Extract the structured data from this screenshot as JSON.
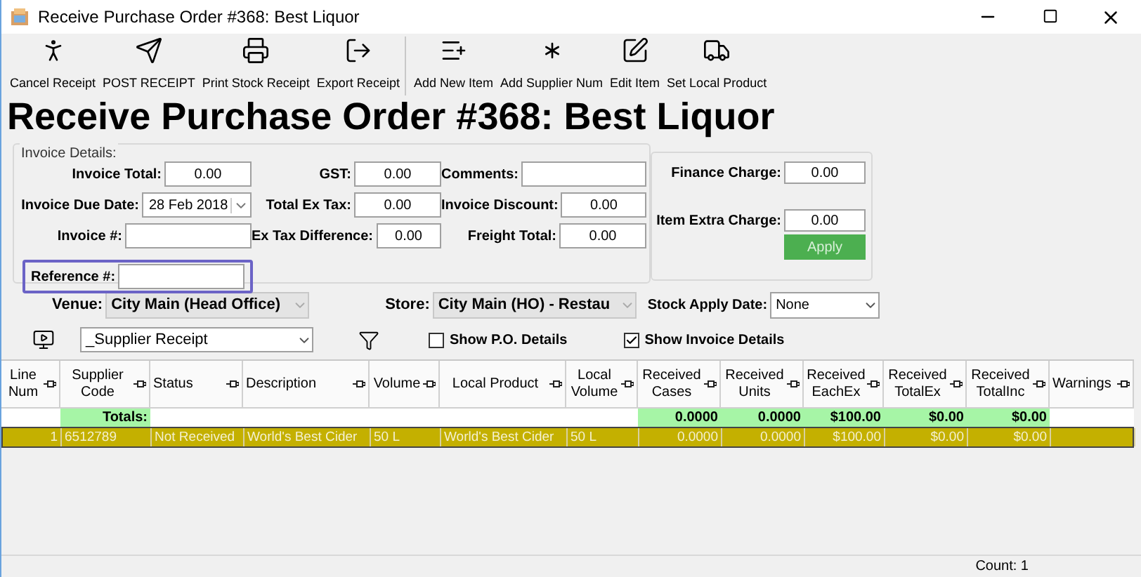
{
  "window": {
    "title": "Receive Purchase Order #368: Best Liquor"
  },
  "toolbar": {
    "groups": [
      [
        {
          "label": "Cancel Receipt"
        },
        {
          "label": "POST RECEIPT"
        },
        {
          "label": "Print Stock Receipt"
        },
        {
          "label": "Export Receipt"
        }
      ],
      [
        {
          "label": "Add New Item"
        },
        {
          "label": "Add Supplier Num"
        },
        {
          "label": "Edit Item"
        },
        {
          "label": "Set Local Product"
        }
      ]
    ]
  },
  "heading": "Receive Purchase Order #368: Best Liquor",
  "invoice_details": {
    "title": "Invoice Details:",
    "rows": [
      [
        {
          "label": "Invoice Total:",
          "value": "0.00",
          "kind": "number"
        },
        {
          "label": "GST:",
          "value": "0.00",
          "kind": "number"
        },
        {
          "label": "Comments:",
          "kind": "wide"
        }
      ],
      [
        {
          "label": "Invoice Due Date:",
          "value": "28 Feb 2018",
          "kind": "date"
        },
        {
          "label": "Total Ex Tax:",
          "value": "0.00",
          "kind": "number"
        },
        {
          "label": "Invoice Discount:",
          "value": "0.00",
          "kind": "number"
        }
      ],
      [
        {
          "label": "Invoice #:",
          "kind": "text"
        },
        {
          "label": "Ex Tax Difference:",
          "value": "0.00",
          "kind": "number"
        },
        {
          "label": "Freight Total:",
          "value": "0.00",
          "kind": "number"
        }
      ],
      [
        {
          "label": "Reference #:",
          "kind": "text",
          "highlighted": true
        }
      ]
    ],
    "charges": [
      {
        "label": "Finance Charge:",
        "value": "0.00"
      },
      {
        "label": "Item Extra Charge:",
        "value": "0.00"
      }
    ],
    "apply_button": "Apply"
  },
  "selectors": [
    {
      "label": "Venue:",
      "value": "City Main (Head Office)",
      "disabled": true
    },
    {
      "label": "Store:",
      "value": "City Main (HO) - Restau",
      "disabled": true
    },
    {
      "label": "Stock Apply Date:",
      "value": "None",
      "disabled": false
    }
  ],
  "view_select": {
    "value": "_Supplier Receipt"
  },
  "checkboxes": [
    {
      "label": "Show P.O. Details",
      "checked": false
    },
    {
      "label": "Show Invoice Details",
      "checked": true
    }
  ],
  "table": {
    "columns": [
      "Line Num",
      "Supplier Code",
      "Status",
      "Description",
      "Volume",
      "Local Product",
      "Local Volume",
      "Received Cases",
      "Received Units",
      "Received EachEx",
      "Received TotalEx",
      "Received TotalInc",
      "Warnings"
    ],
    "totals": {
      "label": "Totals:",
      "values": [
        "0.0000",
        "0.0000",
        "$100.00",
        "$0.00",
        "$0.00"
      ]
    },
    "rows": [
      {
        "selected": true,
        "cells": [
          "1",
          "6512789",
          "Not Received",
          "World's Best Cider",
          "50 L",
          "World's Best Cider",
          "50 L",
          "0.0000",
          "0.0000",
          "$100.00",
          "$0.00",
          "$0.00"
        ]
      }
    ]
  },
  "status_bar": {
    "count": "Count: 1"
  }
}
